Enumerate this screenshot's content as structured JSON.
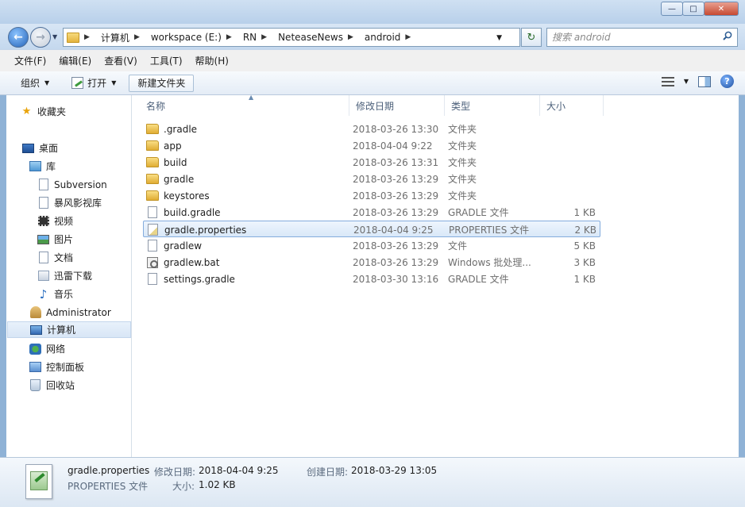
{
  "address": {
    "crumbs": [
      "计算机",
      "workspace (E:)",
      "RN",
      "NeteaseNews",
      "android"
    ]
  },
  "search": {
    "placeholder": "搜索 android"
  },
  "menu": [
    "文件(F)",
    "编辑(E)",
    "查看(V)",
    "工具(T)",
    "帮助(H)"
  ],
  "toolbar": {
    "organize": "组织",
    "open": "打开",
    "new_folder": "新建文件夹"
  },
  "nav": {
    "favorites": "收藏夹",
    "desktop": "桌面",
    "library": "库",
    "library_items": [
      "Subversion",
      "暴风影视库",
      "视频",
      "图片",
      "文档",
      "迅雷下载",
      "音乐"
    ],
    "admin": "Administrator",
    "computer": "计算机",
    "network": "网络",
    "control_panel": "控制面板",
    "recycle_bin": "回收站"
  },
  "columns": {
    "name": "名称",
    "modified": "修改日期",
    "type": "类型",
    "size": "大小"
  },
  "files": [
    {
      "name": ".gradle",
      "modified": "2018-03-26 13:30",
      "type": "文件夹",
      "size": "",
      "icon": "folder-icon"
    },
    {
      "name": "app",
      "modified": "2018-04-04 9:22",
      "type": "文件夹",
      "size": "",
      "icon": "folder-icon"
    },
    {
      "name": "build",
      "modified": "2018-03-26 13:31",
      "type": "文件夹",
      "size": "",
      "icon": "folder-icon"
    },
    {
      "name": "gradle",
      "modified": "2018-03-26 13:29",
      "type": "文件夹",
      "size": "",
      "icon": "folder-icon"
    },
    {
      "name": "keystores",
      "modified": "2018-03-26 13:29",
      "type": "文件夹",
      "size": "",
      "icon": "folder-icon"
    },
    {
      "name": "build.gradle",
      "modified": "2018-03-26 13:29",
      "type": "GRADLE 文件",
      "size": "1 KB",
      "icon": "file-icon"
    },
    {
      "name": "gradle.properties",
      "modified": "2018-04-04 9:25",
      "type": "PROPERTIES 文件",
      "size": "2 KB",
      "icon": "properties-file-icon"
    },
    {
      "name": "gradlew",
      "modified": "2018-03-26 13:29",
      "type": "文件",
      "size": "5 KB",
      "icon": "file-icon"
    },
    {
      "name": "gradlew.bat",
      "modified": "2018-03-26 13:29",
      "type": "Windows 批处理...",
      "size": "3 KB",
      "icon": "batch-file-icon"
    },
    {
      "name": "settings.gradle",
      "modified": "2018-03-30 13:16",
      "type": "GRADLE 文件",
      "size": "1 KB",
      "icon": "file-icon"
    }
  ],
  "selected_index": 6,
  "details": {
    "name": "gradle.properties",
    "type": "PROPERTIES 文件",
    "modified_label": "修改日期:",
    "modified": "2018-04-04 9:25",
    "size_label": "大小:",
    "size": "1.02 KB",
    "created_label": "创建日期:",
    "created": "2018-03-29 13:05"
  },
  "colors": {
    "selection": "#d9e8f8",
    "selection_border": "#84acdd",
    "frame": "#c4d8ee"
  }
}
